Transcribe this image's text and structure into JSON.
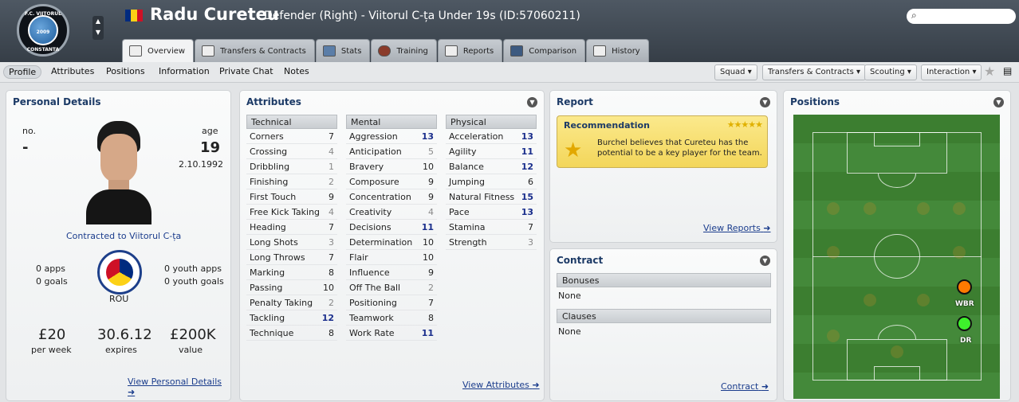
{
  "header": {
    "club_crest_text_top": "F.C. VIITORUL",
    "club_crest_text_bottom": "CONSTANTA",
    "club_crest_year": "2009",
    "player_name": "Radu Cureteu",
    "player_description": "Defender (Right) - Viitorul C-ța Under 19s (ID:57060211)",
    "flag_colors": [
      "#002b7f",
      "#fcd116",
      "#ce1126"
    ]
  },
  "tabs": [
    {
      "label": "Overview",
      "icon": "overview-icon"
    },
    {
      "label": "Transfers & Contracts",
      "icon": "document-icon"
    },
    {
      "label": "Stats",
      "icon": "stats-icon"
    },
    {
      "label": "Training",
      "icon": "ball-icon"
    },
    {
      "label": "Reports",
      "icon": "report-icon"
    },
    {
      "label": "Comparison",
      "icon": "comparison-icon"
    },
    {
      "label": "History",
      "icon": "history-icon"
    }
  ],
  "subnav": {
    "items": [
      "Profile",
      "Attributes",
      "Positions",
      "Information",
      "Private Chat",
      "Notes"
    ],
    "dropdowns": [
      "Squad",
      "Transfers & Contracts",
      "Scouting",
      "Interaction"
    ]
  },
  "personal": {
    "title": "Personal Details",
    "no_label": "no.",
    "no_value": "-",
    "age_label": "age",
    "age_value": "19",
    "dob": "2.10.1992",
    "contract_status": "Contracted to Viitorul C-ța",
    "apps": "0 apps",
    "goals": "0 goals",
    "youth_apps": "0 youth apps",
    "youth_goals": "0 youth goals",
    "nation_code": "ROU",
    "wage": "£20",
    "wage_label": "per week",
    "expires": "30.6.12",
    "expires_label": "expires",
    "value": "£200K",
    "value_label": "value",
    "view_link": "View Personal Details"
  },
  "attributes": {
    "title": "Attributes",
    "view_link": "View Attributes",
    "technical": {
      "header": "Technical",
      "rows": [
        [
          "Corners",
          "7"
        ],
        [
          "Crossing",
          "4"
        ],
        [
          "Dribbling",
          "1"
        ],
        [
          "Finishing",
          "2"
        ],
        [
          "First Touch",
          "9"
        ],
        [
          "Free Kick Taking",
          "4"
        ],
        [
          "Heading",
          "7"
        ],
        [
          "Long Shots",
          "3"
        ],
        [
          "Long Throws",
          "7"
        ],
        [
          "Marking",
          "8"
        ],
        [
          "Passing",
          "10"
        ],
        [
          "Penalty Taking",
          "2"
        ],
        [
          "Tackling",
          "12"
        ],
        [
          "Technique",
          "8"
        ]
      ]
    },
    "mental": {
      "header": "Mental",
      "rows": [
        [
          "Aggression",
          "13"
        ],
        [
          "Anticipation",
          "5"
        ],
        [
          "Bravery",
          "10"
        ],
        [
          "Composure",
          "9"
        ],
        [
          "Concentration",
          "9"
        ],
        [
          "Creativity",
          "4"
        ],
        [
          "Decisions",
          "11"
        ],
        [
          "Determination",
          "10"
        ],
        [
          "Flair",
          "10"
        ],
        [
          "Influence",
          "9"
        ],
        [
          "Off The Ball",
          "2"
        ],
        [
          "Positioning",
          "7"
        ],
        [
          "Teamwork",
          "8"
        ],
        [
          "Work Rate",
          "11"
        ]
      ]
    },
    "physical": {
      "header": "Physical",
      "rows": [
        [
          "Acceleration",
          "13"
        ],
        [
          "Agility",
          "11"
        ],
        [
          "Balance",
          "12"
        ],
        [
          "Jumping",
          "6"
        ],
        [
          "Natural Fitness",
          "15"
        ],
        [
          "Pace",
          "13"
        ],
        [
          "Stamina",
          "7"
        ],
        [
          "Strength",
          "3"
        ]
      ]
    }
  },
  "report": {
    "title": "Report",
    "rec_title": "Recommendation",
    "stars": "★★★★★",
    "text": "Burchel believes that Cureteu has the potential to be a key player for the team.",
    "view_link": "View Reports"
  },
  "contract": {
    "title": "Contract",
    "bonuses_header": "Bonuses",
    "bonuses_value": "None",
    "clauses_header": "Clauses",
    "clauses_value": "None",
    "link": "Contract"
  },
  "positions": {
    "title": "Positions",
    "markers": [
      {
        "label": "WBR",
        "color": "#ff7a00"
      },
      {
        "label": "DR",
        "color": "#3ef02c"
      }
    ]
  }
}
